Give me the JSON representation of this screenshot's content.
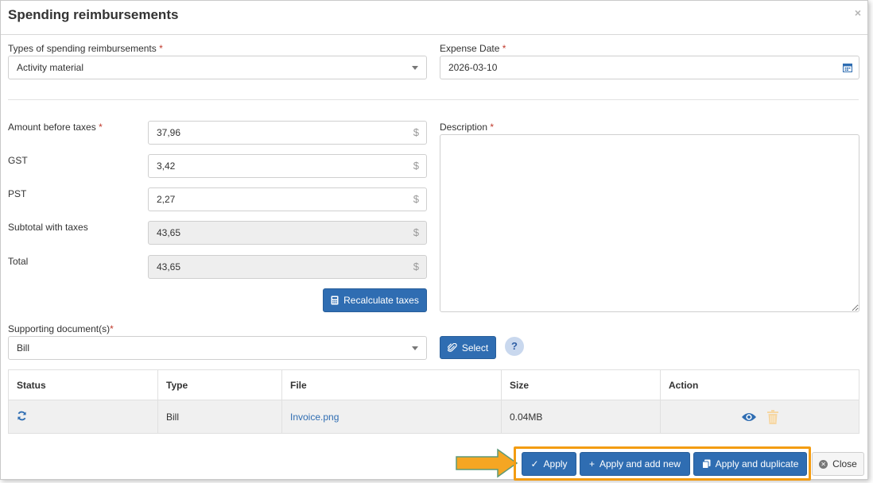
{
  "dialog": {
    "title": "Spending reimbursements",
    "close_glyph": "×"
  },
  "form": {
    "type_label": "Types of spending reimbursements",
    "type_value": "Activity material",
    "date_label": "Expense Date",
    "date_value": "2026-03-10",
    "amount_label": "Amount before taxes",
    "amount_value": "37,96",
    "gst_label": "GST",
    "gst_value": "3,42",
    "pst_label": "PST",
    "pst_value": "2,27",
    "subtotal_label": "Subtotal with taxes",
    "subtotal_value": "43,65",
    "total_label": "Total",
    "total_value": "43,65",
    "currency_symbol": "$",
    "required_mark": "*",
    "description_label": "Description",
    "description_value": "",
    "recalc_label": "Recalculate taxes",
    "docs_label": "Supporting document(s)",
    "docs_value": "Bill",
    "select_label": "Select",
    "help_glyph": "?"
  },
  "table": {
    "headers": [
      "Status",
      "Type",
      "File",
      "Size",
      "Action"
    ],
    "rows": [
      {
        "type": "Bill",
        "file": "Invoice.png",
        "size": "0.04MB"
      }
    ]
  },
  "footer": {
    "apply_label": "Apply",
    "apply_add_label": "Apply and add new",
    "apply_dup_label": "Apply and duplicate",
    "close_label": "Close"
  },
  "colors": {
    "primary": "#2f6db2",
    "highlight": "#f39c12",
    "required": "#c0392b"
  },
  "icons": [
    "calendar-icon",
    "calculator-icon",
    "paperclip-icon",
    "refresh-icon",
    "eye-icon",
    "trash-icon",
    "check-icon",
    "plus-icon",
    "copy-icon",
    "close-circle-icon",
    "arrow-right-icon"
  ]
}
